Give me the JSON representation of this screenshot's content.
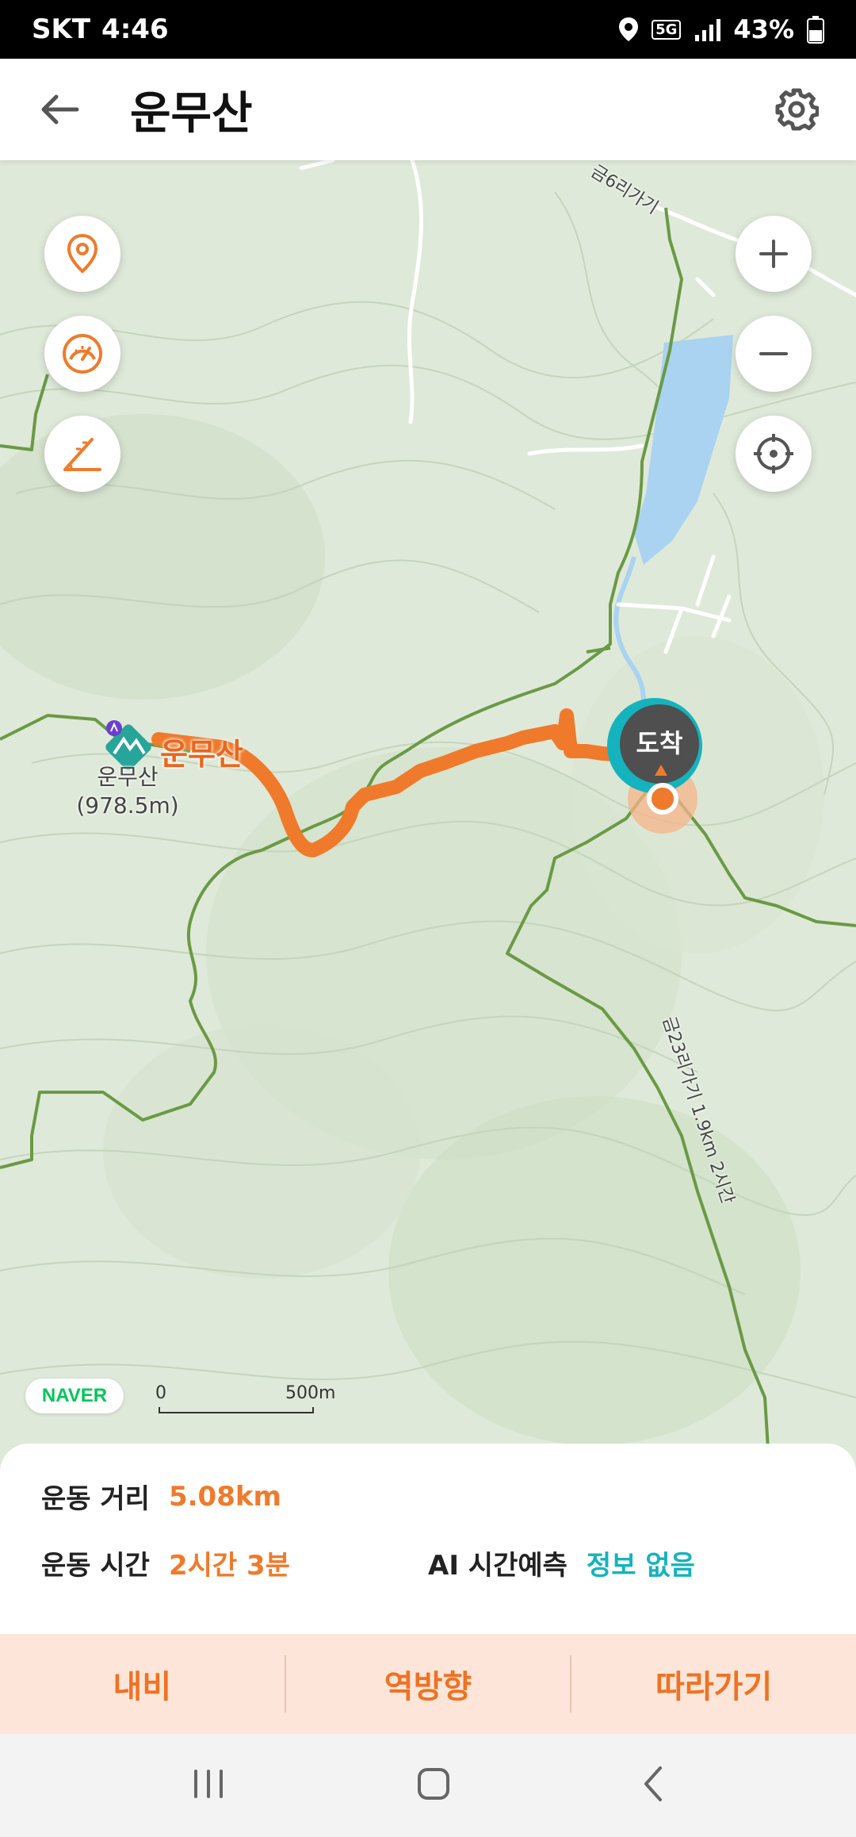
{
  "status_bar": {
    "carrier": "SKT",
    "time": "4:46",
    "network": "5G",
    "battery": "43%"
  },
  "header": {
    "title": "운무산",
    "back_icon": "arrow-left-icon",
    "settings_icon": "gear-icon"
  },
  "map": {
    "peak_name": "운무산",
    "peak_label": "운무산",
    "peak_elevation": "(978.5m)",
    "end_marker_label": "도착",
    "provider_logo": "NAVER",
    "scale_start": "0",
    "scale_end": "500m",
    "trail_label_1": "금6리가기",
    "trail_label_2": "금23리가기 1.9km 2시간",
    "controls_left": [
      "location-pin-icon",
      "speedometer-icon",
      "slope-icon"
    ],
    "controls_right": [
      "zoom-in-icon",
      "zoom-out-icon",
      "crosshair-icon"
    ],
    "colors": {
      "route": "#f07a2b",
      "trail": "#6a9a45",
      "water": "#a9d3f0",
      "accent": "#14b3be"
    }
  },
  "stats": {
    "distance_label": "운동 거리",
    "distance_value": "5.08km",
    "time_label": "운동 시간",
    "time_value": "2시간 3분",
    "ai_label": "AI 시간예측",
    "ai_value": "정보 없음"
  },
  "actions": {
    "navi": "내비",
    "reverse": "역방향",
    "follow": "따라가기"
  },
  "nav_bar": [
    "recent-apps-icon",
    "home-icon",
    "back-icon"
  ]
}
